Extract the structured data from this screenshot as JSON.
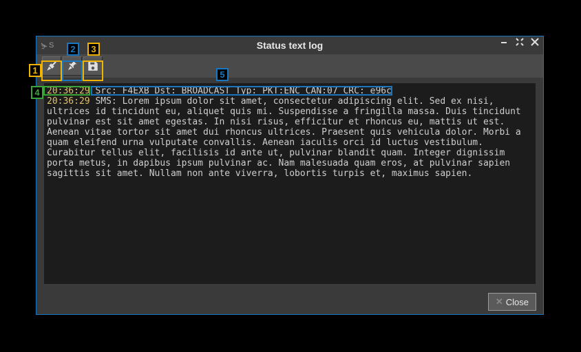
{
  "window": {
    "app_tag": "S",
    "title": "Status text log"
  },
  "toolbar": {
    "clear_tooltip": "Clear",
    "pin_tooltip": "Pin",
    "save_tooltip": "Save"
  },
  "log": {
    "entries": [
      {
        "time": "20:36:29",
        "text": "Src: F4EXB Dst: BROADCAST Typ: PKT:ENC CAN:07 CRC: e96c"
      },
      {
        "time": "20:36:29",
        "text": "SMS: Lorem ipsum dolor sit amet, consectetur adipiscing elit. Sed ex nisi, ultrices id tincidunt eu, aliquet quis mi. Suspendisse a fringilla massa. Duis tincidunt pulvinar est sit amet egestas. In nisi risus, efficitur et rhoncus eu, mattis ut est. Aenean vitae tortor sit amet dui rhoncus ultrices. Praesent quis vehicula dolor. Morbi a quam eleifend urna vulputate convallis. Aenean iaculis orci id luctus vestibulum. Curabitur tellus elit, facilisis id ante ut, pulvinar blandit quam. Integer dignissim porta metus, in dapibus ipsum pulvinar ac. Nam malesuada quam eros, at pulvinar sapien sagittis sit amet. Nullam non ante viverra, lobortis turpis et, maximus sapien."
      }
    ]
  },
  "footer": {
    "close_label": "Close"
  },
  "annotations": {
    "1": "clear-button",
    "2": "pin-button",
    "3": "save-button",
    "4": "timestamp",
    "5": "status-header-line"
  }
}
